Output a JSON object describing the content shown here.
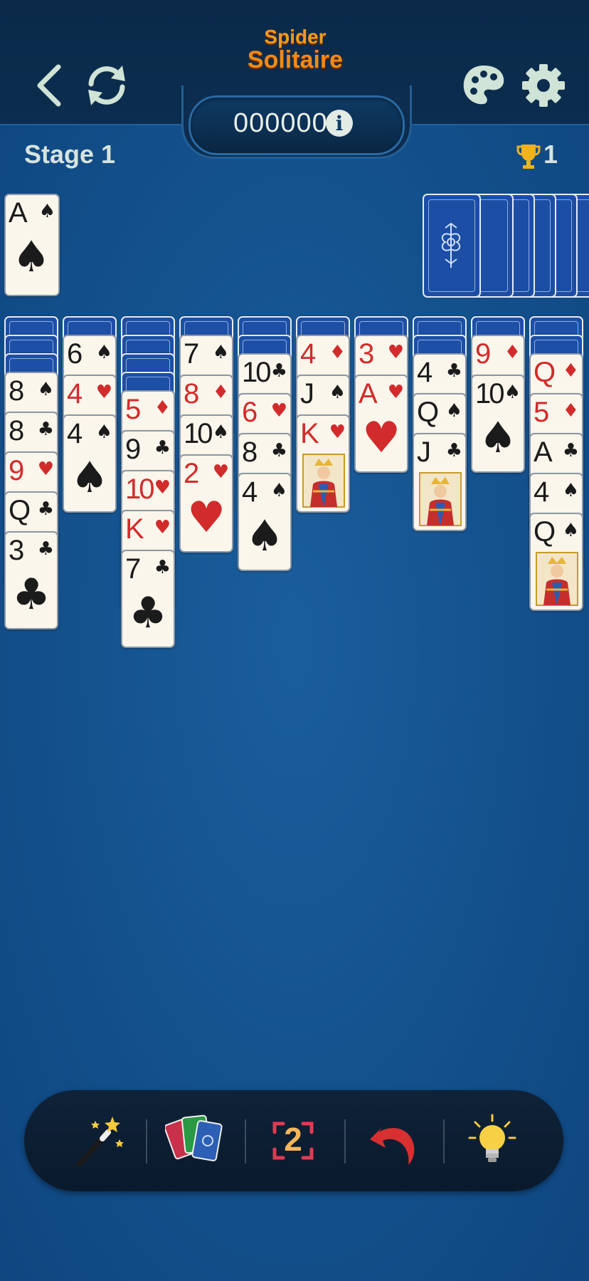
{
  "header": {
    "logo_line1": "Spider",
    "logo_line2": "Solitaire",
    "score": "000000",
    "info_glyph": "i",
    "stage": "Stage 1",
    "trophies": "1",
    "icons": [
      "back-icon",
      "restart-icon",
      "palette-icon",
      "gear-icon",
      "info-icon",
      "trophy-icon"
    ]
  },
  "foundation": {
    "rank": "A",
    "suit": "♠"
  },
  "stock": {
    "piles": 6
  },
  "columns": [
    {
      "hidden": 3,
      "cards": [
        [
          "8",
          "♠"
        ],
        [
          "8",
          "♣"
        ],
        [
          "9",
          "♥"
        ],
        [
          "Q",
          "♣"
        ],
        [
          "3",
          "♣"
        ]
      ]
    },
    {
      "hidden": 1,
      "cards": [
        [
          "6",
          "♠"
        ],
        [
          "4",
          "♥"
        ],
        [
          "4",
          "♠"
        ]
      ]
    },
    {
      "hidden": 4,
      "cards": [
        [
          "5",
          "♦"
        ],
        [
          "9",
          "♣"
        ],
        [
          "10",
          "♥"
        ],
        [
          "K",
          "♥"
        ],
        [
          "7",
          "♣"
        ]
      ]
    },
    {
      "hidden": 1,
      "cards": [
        [
          "7",
          "♠"
        ],
        [
          "8",
          "♦"
        ],
        [
          "10",
          "♠"
        ],
        [
          "2",
          "♥"
        ]
      ]
    },
    {
      "hidden": 2,
      "cards": [
        [
          "10",
          "♣"
        ],
        [
          "6",
          "♥"
        ],
        [
          "8",
          "♣"
        ],
        [
          "4",
          "♠"
        ]
      ]
    },
    {
      "hidden": 1,
      "cards": [
        [
          "4",
          "♦"
        ],
        [
          "J",
          "♠"
        ],
        [
          "K",
          "♥"
        ]
      ]
    },
    {
      "hidden": 1,
      "cards": [
        [
          "3",
          "♥"
        ],
        [
          "A",
          "♥"
        ]
      ]
    },
    {
      "hidden": 2,
      "cards": [
        [
          "4",
          "♣"
        ],
        [
          "Q",
          "♠"
        ],
        [
          "J",
          "♣"
        ]
      ]
    },
    {
      "hidden": 1,
      "cards": [
        [
          "9",
          "♦"
        ],
        [
          "10",
          "♠"
        ]
      ]
    },
    {
      "hidden": 2,
      "cards": [
        [
          "Q",
          "♦"
        ],
        [
          "5",
          "♦"
        ],
        [
          "A",
          "♣"
        ],
        [
          "4",
          "♠"
        ],
        [
          "Q",
          "♠"
        ]
      ]
    }
  ],
  "toolbar": {
    "items": [
      "magic-wand-icon",
      "deck-icon",
      "multiplier-icon",
      "undo-icon",
      "hint-bulb-icon"
    ],
    "multiplier": "2"
  },
  "colors": {
    "table": "#14538f",
    "card_red": "#d22b2b",
    "card_black": "#1b1b1b",
    "card_back": "#1d4fa6"
  }
}
